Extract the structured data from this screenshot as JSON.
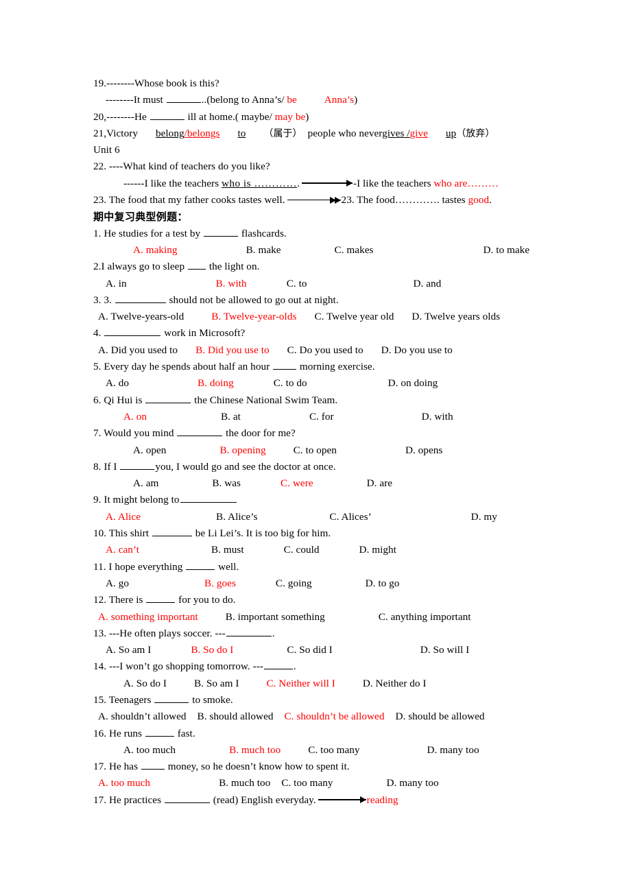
{
  "document": {
    "type": "english-grammar-worksheet",
    "colors": {
      "answer_highlight": "#ff0000",
      "text": "#000000",
      "background": "#ffffff"
    },
    "top_section": {
      "q19": {
        "line1": "19.--------Whose book is this?",
        "line2_pre": "--------It must ",
        "line2_mid": "..(belong to Anna’s/ ",
        "line2_answer1": "be",
        "line2_answer2": "Anna’s",
        "line2_end": ")"
      },
      "q20": {
        "pre": "20,--------He ",
        "mid": " ill at home.( maybe/ ",
        "answer": "may be",
        "end": ")"
      },
      "q21": {
        "pre": "21,Victory",
        "opt_black": "belong",
        "opt_red": "/belongs",
        "blank_word": "to",
        "paren_cjk": "（属于）",
        "mid": "people who never",
        "verb_black": "gives /",
        "verb_red": "give",
        "tail_word": "up",
        "tail_cjk": "（放弃）"
      },
      "unit": "Unit 6",
      "q22": {
        "line1": "22. ----What kind of teachers do you like?",
        "line2_pre": "------I like the teachers ",
        "line2_underlined": "who is …………",
        "line2_after_arrow": "-I like the teachers ",
        "line2_answer": "who are………"
      },
      "q23": {
        "pre": "23. The food that my father cooks tastes well.",
        "after_arrow": "23. The food…………. tastes ",
        "answer": "good",
        "end": "."
      }
    },
    "section_heading": "期中复习典型例题：",
    "questions": [
      {
        "number": "1.",
        "stem_pre": "1. He studies for a test by ",
        "stem_post": " flashcards.",
        "options": [
          {
            "label": "A. making",
            "correct": true
          },
          {
            "label": "B. make",
            "correct": false
          },
          {
            "label": "C. makes",
            "correct": false
          },
          {
            "label": "D. to make",
            "correct": false
          }
        ]
      },
      {
        "number": "2.",
        "stem_pre": "2.I always go to sleep ",
        "stem_post": " the light on.",
        "options": [
          {
            "label": "A. in",
            "correct": false
          },
          {
            "label": "B. with",
            "correct": true
          },
          {
            "label": "C. to",
            "correct": false
          },
          {
            "label": "D. and",
            "correct": false
          }
        ]
      },
      {
        "number": "3.",
        "stem_pre": "3.   3. ",
        "stem_post": " should not be allowed    to go out at night.",
        "options": [
          {
            "label": "A. Twelve-years-old",
            "correct": false
          },
          {
            "label": "B. Twelve-year-olds",
            "correct": true
          },
          {
            "label": "C. Twelve year old",
            "correct": false
          },
          {
            "label": "D. Twelve years olds",
            "correct": false
          }
        ]
      },
      {
        "number": "4.",
        "stem_pre": "4. ",
        "stem_post": " work in Microsoft?",
        "options": [
          {
            "label": "A. Did you used to",
            "correct": false
          },
          {
            "label": "B. Did you use to",
            "correct": true
          },
          {
            "label": "C. Do you used to",
            "correct": false
          },
          {
            "label": "D. Do you use to",
            "correct": false
          }
        ]
      },
      {
        "number": "5.",
        "stem_pre": "5. Every day he spends about half an hour ",
        "stem_post": " morning   exercise.",
        "options": [
          {
            "label": "A. do",
            "correct": false
          },
          {
            "label": "B. doing",
            "correct": true
          },
          {
            "label": "C. to do",
            "correct": false
          },
          {
            "label": "D. on doing",
            "correct": false
          }
        ]
      },
      {
        "number": "6.",
        "stem_pre": "6. Qi Hui is ",
        "stem_post": " the Chinese National Swim Team.",
        "options": [
          {
            "label": "A. on",
            "correct": true
          },
          {
            "label": "B. at",
            "correct": false
          },
          {
            "label": "C. for",
            "correct": false
          },
          {
            "label": "D. with",
            "correct": false
          }
        ]
      },
      {
        "number": "7.",
        "stem_pre": "7. Would you mind ",
        "stem_post": " the   door for me?",
        "options": [
          {
            "label": "A. open",
            "correct": false
          },
          {
            "label": "B. opening",
            "correct": true
          },
          {
            "label": "C. to open",
            "correct": false
          },
          {
            "label": "D. opens",
            "correct": false
          }
        ]
      },
      {
        "number": "8.",
        "stem_pre": "8. If I ",
        "stem_post": "you, I would go and see the doctor at once.",
        "options": [
          {
            "label": "A. am",
            "correct": false
          },
          {
            "label": "B. was",
            "correct": false
          },
          {
            "label": "C. were",
            "correct": true
          },
          {
            "label": "D. are",
            "correct": false
          }
        ]
      },
      {
        "number": "9.",
        "stem_pre": "9. It might belong to",
        "stem_post": "",
        "options": [
          {
            "label": "A. Alice",
            "correct": true
          },
          {
            "label": "B. Alice’s",
            "correct": false
          },
          {
            "label": "C. Alices’",
            "correct": false
          },
          {
            "label": "D. my",
            "correct": false
          }
        ]
      },
      {
        "number": "10.",
        "stem_pre": "10. This shirt ",
        "stem_post": " be Li Lei’s.   It is too big for him.",
        "options": [
          {
            "label": "A. can’t",
            "correct": true
          },
          {
            "label": "B. must",
            "correct": false
          },
          {
            "label": "C. could",
            "correct": false
          },
          {
            "label": "D. might",
            "correct": false
          }
        ]
      },
      {
        "number": "11.",
        "stem_pre": "11. I hope everything ",
        "stem_post": " well.",
        "options": [
          {
            "label": "A. go",
            "correct": false
          },
          {
            "label": "B. goes",
            "correct": true
          },
          {
            "label": "C. going",
            "correct": false
          },
          {
            "label": "D. to go",
            "correct": false
          }
        ]
      },
      {
        "number": "12.",
        "stem_pre": "12. There is ",
        "stem_post": " for you to do.",
        "options": [
          {
            "label": "A. something important",
            "correct": true
          },
          {
            "label": "B. important something",
            "correct": false
          },
          {
            "label": "C. anything important",
            "correct": false
          }
        ]
      },
      {
        "number": "13.",
        "stem_pre": "13. ---He often plays soccer.        ---",
        "stem_post": ".",
        "options": [
          {
            "label": "A. So am I",
            "correct": false
          },
          {
            "label": "B. So do I",
            "correct": true
          },
          {
            "label": "C. So did I",
            "correct": false
          },
          {
            "label": "D. So will I",
            "correct": false
          }
        ]
      },
      {
        "number": "14.",
        "stem_pre": "14. ---I won’t go shopping tomorrow.      ---",
        "stem_post": ".",
        "options": [
          {
            "label": "A. So do I",
            "correct": false
          },
          {
            "label": "B. So am I",
            "correct": false
          },
          {
            "label": "C. Neither will I",
            "correct": true
          },
          {
            "label": "D. Neither do I",
            "correct": false
          }
        ]
      },
      {
        "number": "15.",
        "stem_pre": "15. Teenagers ",
        "stem_post": " to smoke.",
        "options": [
          {
            "label": "A. shouldn’t allowed",
            "correct": false
          },
          {
            "label": "B. should allowed",
            "correct": false
          },
          {
            "label": "C. shouldn’t be allowed",
            "correct": true
          },
          {
            "label": "D. should be allowed",
            "correct": false
          }
        ]
      },
      {
        "number": "16.",
        "stem_pre": "16. He runs ",
        "stem_post": " fast.",
        "options": [
          {
            "label": "A. too much",
            "correct": false
          },
          {
            "label": "B. much too",
            "correct": true
          },
          {
            "label": "C. too many",
            "correct": false
          },
          {
            "label": "D. many too",
            "correct": false
          }
        ]
      },
      {
        "number": "17.",
        "stem_pre": "17. He has ",
        "stem_post": " money, so he doesn’t know how to spent it.",
        "options": [
          {
            "label": "A. too much",
            "correct": true
          },
          {
            "label": "B. much too",
            "correct": false
          },
          {
            "label": "C. too many",
            "correct": false
          },
          {
            "label": "D. many too",
            "correct": false
          }
        ]
      }
    ],
    "last_line": {
      "pre": "17. He practices ",
      "post": " (read) English everyday.",
      "answer": "reading"
    }
  }
}
